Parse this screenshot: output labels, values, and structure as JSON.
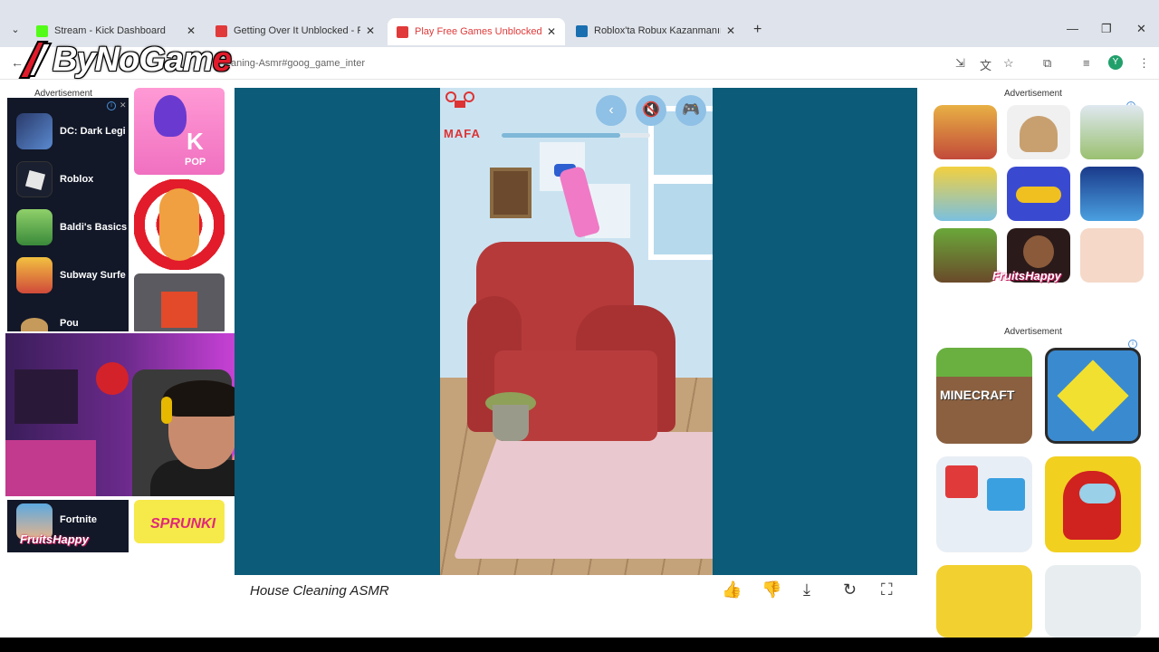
{
  "browser": {
    "tabs": [
      {
        "label": "Stream - Kick Dashboard",
        "favicon_color": "#53fc18"
      },
      {
        "label": "Getting Over It Unblocked - Pla",
        "favicon_color": "#e03a3a"
      },
      {
        "label": "Play Free Games Unblocked At",
        "favicon_color": "#e03a3a"
      },
      {
        "label": "Roblox'ta Robux Kazanmanın G",
        "favicon_color": "#1a6fb0"
      }
    ],
    "new_tab": "+",
    "url_fragment": "aning-Asmr#goog_game_inter",
    "profile_initial": "Y"
  },
  "logo": {
    "text_main": "ByNoGam",
    "text_end": "e"
  },
  "left_ad": {
    "label": "Advertisement",
    "games": [
      {
        "name": "DC: Dark Legi"
      },
      {
        "name": "Roblox"
      },
      {
        "name": "Baldi's Basics"
      },
      {
        "name": "Subway Surfe"
      },
      {
        "name": "Pou"
      }
    ],
    "thumbs": [
      "K POP",
      "Kick the Buddy",
      "Pixel"
    ],
    "fortnite": {
      "name": "Fortnite",
      "fruits": "FruitsHappy"
    },
    "sprunki": "SPRUNKI"
  },
  "game": {
    "title": "House Cleaning ASMR",
    "brand_top": "MAFA",
    "progress": 0.8
  },
  "right_ad": {
    "label_top": "Advertisement",
    "label_bottom": "Advertisement",
    "fruits": "FruitsHappy",
    "minecraft_label": "MINECRAFT"
  }
}
